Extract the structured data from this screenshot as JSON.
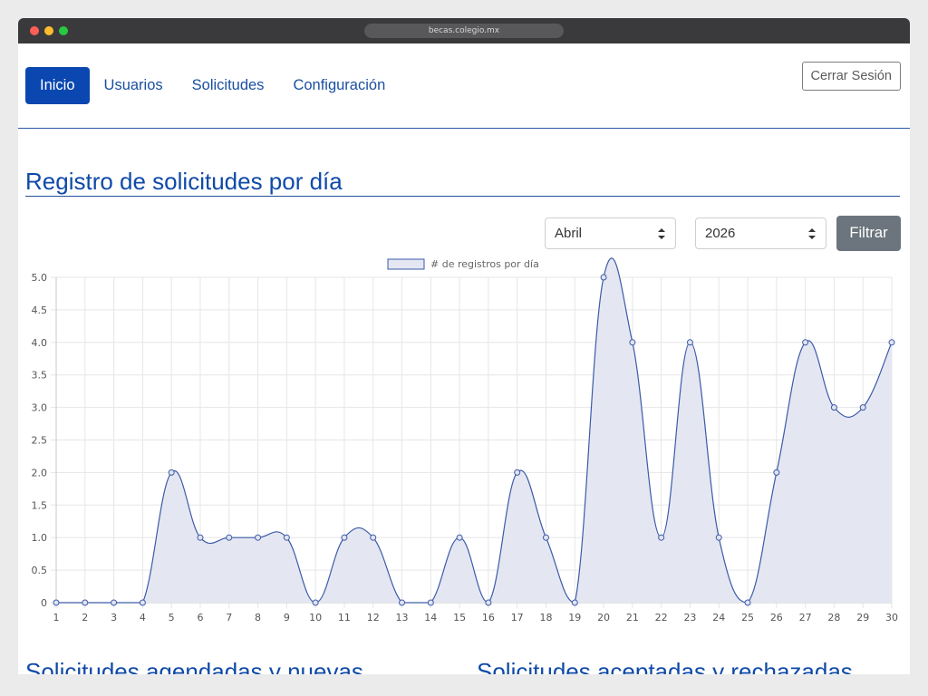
{
  "browser": {
    "url": "becas.colegio.mx"
  },
  "nav": {
    "items": [
      {
        "label": "Inicio",
        "active": true
      },
      {
        "label": "Usuarios",
        "active": false
      },
      {
        "label": "Solicitudes",
        "active": false
      },
      {
        "label": "Configuración",
        "active": false
      }
    ],
    "logout_label": "Cerrar Sesión"
  },
  "main": {
    "title": "Registro de solicitudes por día",
    "filters": {
      "month": "Abril",
      "year": "2026",
      "filter_label": "Filtrar"
    },
    "section_titles": [
      "Solicitudes agendadas y nuevas",
      "Solicitudes aceptadas y rechazadas"
    ]
  },
  "colors": {
    "accent": "#0b47b0",
    "line": "#3d5aa8",
    "fill": "#e4e7f2",
    "filter_button": "#6c757d"
  },
  "chart_data": {
    "type": "area",
    "legend": "# de registros por día",
    "legend_position": "top",
    "grid": true,
    "x": [
      1,
      2,
      3,
      4,
      5,
      6,
      7,
      8,
      9,
      10,
      11,
      12,
      13,
      14,
      15,
      16,
      17,
      18,
      19,
      20,
      21,
      22,
      23,
      24,
      25,
      26,
      27,
      28,
      29,
      30
    ],
    "series": [
      {
        "name": "# de registros por día",
        "values": [
          0,
          0,
          0,
          0,
          2,
          1,
          1,
          1,
          1,
          0,
          1,
          1,
          0,
          0,
          1,
          0,
          2,
          1,
          0,
          5,
          4,
          1,
          4,
          1,
          0,
          2,
          4,
          3,
          3,
          4
        ]
      }
    ],
    "ylim": [
      0,
      5
    ],
    "yticks": [
      "0",
      "0.5",
      "1.0",
      "1.5",
      "2.0",
      "2.5",
      "3.0",
      "3.5",
      "4.0",
      "4.5",
      "5.0"
    ]
  }
}
